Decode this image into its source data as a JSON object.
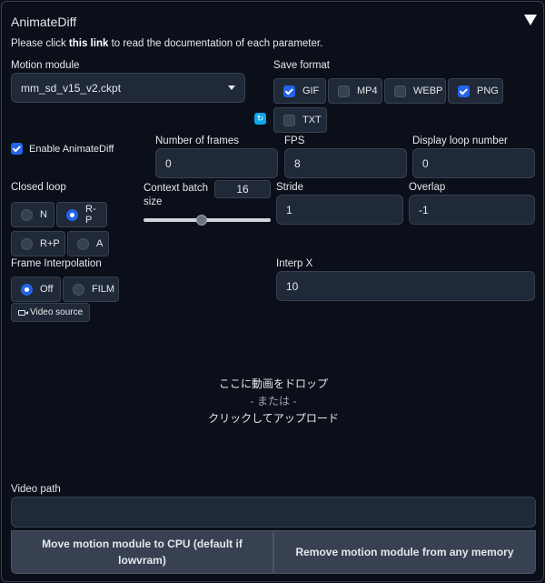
{
  "header": {
    "title": "AnimateDiff"
  },
  "doc": {
    "prefix": "Please click ",
    "link": "this link",
    "suffix": " to read the documentation of each parameter."
  },
  "motion_module": {
    "label": "Motion module",
    "value": "mm_sd_v15_v2.ckpt"
  },
  "save_format": {
    "label": "Save format",
    "options": [
      {
        "label": "GIF",
        "checked": true
      },
      {
        "label": "MP4",
        "checked": false
      },
      {
        "label": "WEBP",
        "checked": false
      },
      {
        "label": "PNG",
        "checked": true
      },
      {
        "label": "TXT",
        "checked": false
      }
    ]
  },
  "enable": {
    "label": "Enable AnimateDiff",
    "checked": true
  },
  "fields": {
    "frames": {
      "label": "Number of frames",
      "value": "0"
    },
    "fps": {
      "label": "FPS",
      "value": "8"
    },
    "loop": {
      "label": "Display loop number",
      "value": "0"
    },
    "stride": {
      "label": "Stride",
      "value": "1"
    },
    "overlap": {
      "label": "Overlap",
      "value": "-1"
    },
    "interp_x": {
      "label": "Interp X",
      "value": "10"
    }
  },
  "closed_loop": {
    "label": "Closed loop",
    "options": [
      "N",
      "R-P",
      "R+P",
      "A"
    ],
    "selected": "R-P"
  },
  "context_batch": {
    "label_line1": "Context batch",
    "label_line2": "size",
    "value": "16",
    "fraction": 0.45
  },
  "frame_interp": {
    "label": "Frame Interpolation",
    "options": [
      "Off",
      "FILM"
    ],
    "selected": "Off"
  },
  "video_source": {
    "label": "Video source",
    "icon": "video-camera-icon"
  },
  "dropzone": {
    "line1": "ここに動画をドロップ",
    "line2": "- または -",
    "line3": "クリックしてアップロード"
  },
  "video_path": {
    "label": "Video path",
    "value": ""
  },
  "buttons": {
    "move_cpu": "Move motion module to CPU (default if lowvram)",
    "remove": "Remove motion module from any memory"
  },
  "colors": {
    "accent": "#2563eb",
    "background": "#0b0f19",
    "field": "#1f2937",
    "button": "#374151"
  }
}
